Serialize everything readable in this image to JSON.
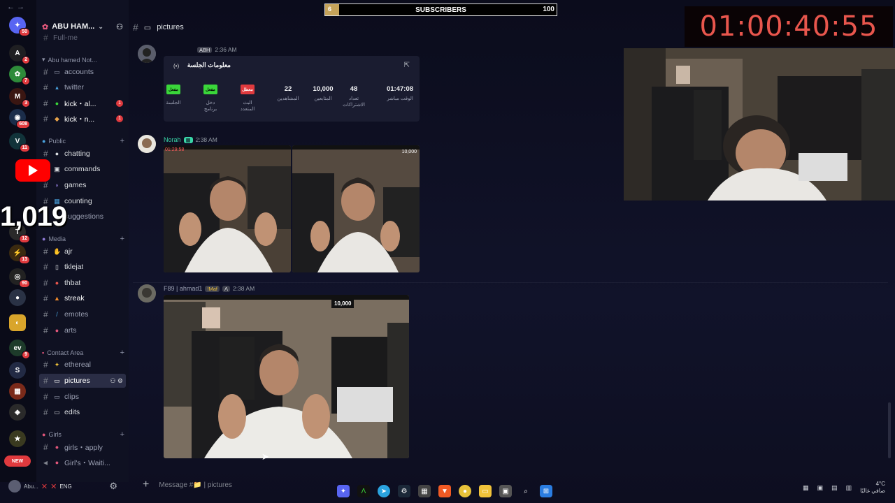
{
  "server": {
    "name": "ABU HAM...",
    "back_icon": "back-arrow-icon"
  },
  "overlay": {
    "subs_left": "6",
    "subs_label": "SUBSCRIBERS",
    "subs_right": "100",
    "subs_progress": 0.06,
    "timer": "01:00:40:55",
    "counter": "1,019"
  },
  "rail_badges": [
    "50",
    "2",
    "7",
    "3",
    "608",
    "11",
    "12",
    "13",
    "90",
    "9",
    "NEW"
  ],
  "categories": {
    "abu": "Abu hamed Not...",
    "public": "Public",
    "media": "Media",
    "contact": "Contact Area",
    "girls": "Girls"
  },
  "channels": {
    "fullme": "Full-me",
    "accounts": "accounts",
    "twitter": "twitter",
    "kick1": "kick・al...",
    "kick2": "kick・n...",
    "chatting": "chatting",
    "commands": "commands",
    "games": "games",
    "counting": "counting",
    "suggestions": "suggestions",
    "ajr": "ajr",
    "tklejat": "tklejat",
    "thbat": "thbat",
    "streak": "streak",
    "emotes": "emotes",
    "arts": "arts",
    "ethereal": "ethereal",
    "pictures": "pictures",
    "clips": "clips",
    "edits": "edits",
    "girlsapply": "girls・apply",
    "girlswait": "Girl's・Waiti..."
  },
  "channel_counts": {
    "kick1": "1",
    "kick2": "1"
  },
  "header": {
    "channel": "pictures"
  },
  "messages": {
    "m1": {
      "tag": "ABH",
      "time": "2:36 AM"
    },
    "embed": {
      "title": "معلومات الجلسة",
      "live": "(•)",
      "stats": [
        {
          "value": "01:47:08",
          "label": "الوقت مباشر"
        },
        {
          "value": "48",
          "label": "تعداد الاشتراكات"
        },
        {
          "value": "10,000",
          "label": "المتابعين"
        },
        {
          "value": "22",
          "label": "المشاهدين"
        }
      ],
      "pills": [
        {
          "text": "معطل",
          "color": "#e03a3e",
          "label": "البث المتعدد"
        },
        {
          "text": "مفعل",
          "color": "#3ad63a",
          "label": "دخل برنامج"
        },
        {
          "text": "مفعل",
          "color": "#3ad63a",
          "label": "الجلسة"
        }
      ]
    },
    "m2": {
      "name": "Norah",
      "time": "2:38 AM"
    },
    "m3": {
      "name": "F89 | ahmad1",
      "tag": "!Maf",
      "time": "2:38 AM"
    }
  },
  "photo_overlays": {
    "p1_timer": "01:29:58",
    "p2_followers": "10,000",
    "p3_followers": "10,000"
  },
  "composer": {
    "placeholder": "Message #📁 | pictures"
  },
  "userbar": {
    "name": "Abu...",
    "lang": "ENG"
  },
  "tray": {
    "weather": "4°C",
    "weather_desc": "صافي غالبًا"
  }
}
